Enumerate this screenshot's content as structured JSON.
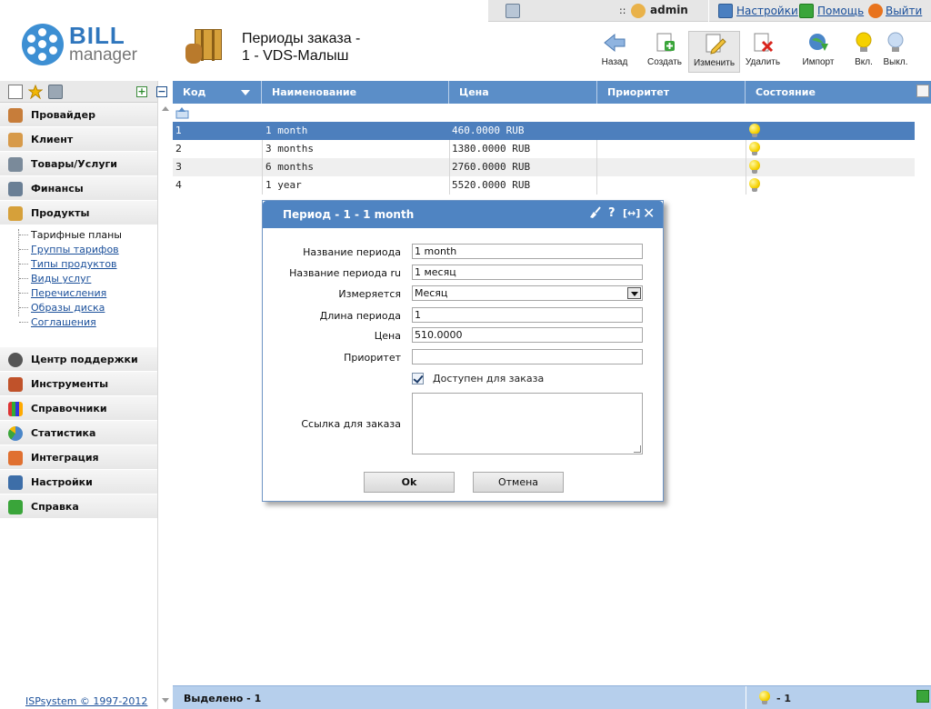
{
  "topbar": {
    "user": "admin",
    "settings": "Настройки",
    "help": "Помощь",
    "logout": "Выйти"
  },
  "logo": {
    "line1": "BILL",
    "line2": "manager"
  },
  "page": {
    "title_line1": "Периоды заказа -",
    "title_line2": "1 - VDS-Малыш"
  },
  "toolbar": [
    {
      "label": "Назад",
      "icon": "arrow-left-icon"
    },
    {
      "label": "Создать",
      "icon": "create-icon"
    },
    {
      "label": "Изменить",
      "icon": "edit-icon"
    },
    {
      "label": "Удалить",
      "icon": "delete-icon"
    },
    {
      "label": "Импорт",
      "icon": "import-icon"
    },
    {
      "label": "Вкл.",
      "icon": "bulb-on-icon"
    },
    {
      "label": "Выкл.",
      "icon": "bulb-off-icon"
    }
  ],
  "sidebar": {
    "menu_top": [
      "Провайдер",
      "Клиент",
      "Товары/Услуги",
      "Финансы",
      "Продукты"
    ],
    "submenu": [
      "Тарифные планы",
      "Группы тарифов",
      "Типы продуктов",
      "Виды услуг",
      "Перечисления",
      "Образы диска",
      "Соглашения"
    ],
    "menu_bottom": [
      "Центр поддержки",
      "Инструменты",
      "Справочники",
      "Статистика",
      "Интеграция",
      "Настройки",
      "Справка"
    ],
    "copyright": "ISPsystem © 1997-2012"
  },
  "grid": {
    "columns": [
      "Код",
      "Наименование",
      "Цена",
      "Приоритет",
      "Состояние"
    ],
    "rows": [
      {
        "code": "1",
        "name": "1 month",
        "price": "460.0000 RUB",
        "priority": ""
      },
      {
        "code": "2",
        "name": "3 months",
        "price": "1380.0000 RUB",
        "priority": ""
      },
      {
        "code": "3",
        "name": "6 months",
        "price": "2760.0000 RUB",
        "priority": ""
      },
      {
        "code": "4",
        "name": "1 year",
        "price": "5520.0000 RUB",
        "priority": ""
      }
    ]
  },
  "status": {
    "selected": "Выделено - 1",
    "count": "- 1"
  },
  "dialog": {
    "title": "Период - 1 - 1 month",
    "fields": {
      "name_label": "Название периода",
      "name_value": "1 month",
      "name_ru_label": "Название периода ru",
      "name_ru_value": "1 месяц",
      "measure_label": "Измеряется",
      "measure_value": "Месяц",
      "length_label": "Длина периода",
      "length_value": "1",
      "price_label": "Цена",
      "price_value": "510.0000",
      "priority_label": "Приоритет",
      "priority_value": "",
      "available_label": "Доступен для заказа",
      "link_label": "Ссылка для заказа"
    },
    "ok": "Ok",
    "cancel": "Отмена"
  },
  "colors": {
    "header_blue": "#5b8ec8",
    "selected_row": "#4d7fbd",
    "status_bar": "#b6cfec",
    "dialog_head": "#4f84c2"
  }
}
